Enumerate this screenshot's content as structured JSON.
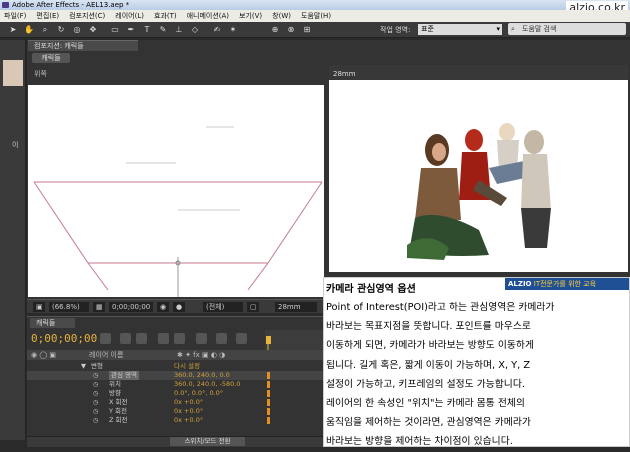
{
  "window": {
    "title": "Adobe After Effects - AEL13.aep *"
  },
  "watermark": "alzio.co.kr",
  "menu": [
    "파일(F)",
    "편집(E)",
    "컴포지션(C)",
    "레이어(L)",
    "효과(T)",
    "애니메이션(A)",
    "보기(V)",
    "창(W)",
    "도움말(H)"
  ],
  "toolbar": {
    "workspace_label": "작업 영역:",
    "workspace_value": "표준",
    "help_placeholder": "도움말 검색"
  },
  "left_panel": {
    "label": "이"
  },
  "composition": {
    "tab_label": "컴포지션: 캐릭들",
    "sub_tab": "캐릭들",
    "view_a_label": "위쪽",
    "view_b_label": "28mm",
    "zoom": "(66.8%)",
    "timecode": "0;00;00;00",
    "view_mode": "(전체)",
    "camera": "28mm"
  },
  "timeline": {
    "tab_label": "캐릭들",
    "timecode": "0;00;00;00",
    "column_header": "레이어 이름",
    "column_header2": "다시 설정",
    "switch_button": "스위치/모드 전환",
    "rows": [
      {
        "name": "변형",
        "value": "다시 설정"
      },
      {
        "name": "관심 영역",
        "value": "360.0, 240.0, 0.0"
      },
      {
        "name": "위치",
        "value": "360.0, 240.0, -580.0"
      },
      {
        "name": "방향",
        "value": "0.0°, 0.0°, 0.0°"
      },
      {
        "name": "X 회전",
        "value": "0x +0.0°"
      },
      {
        "name": "Y 회전",
        "value": "0x +0.0°"
      },
      {
        "name": "Z 회전",
        "value": "0x +0.0°"
      }
    ]
  },
  "info": {
    "title": "카메라 관심영역 옵션",
    "badge_brand": "ALZIO",
    "badge_text": "IT전문가를 위한 교육",
    "lines": [
      "Point of Interest(POI)라고 하는 관심영역은 카메라가",
      "바라보는 목표지점을 뜻합니다. 포인트를 마우스로",
      "이동하게 되면, 카메라가 바라보는 방향도 이동하게",
      "됩니다. 길게 혹은, 짧게 이동이 가능하며, X, Y, Z",
      "설정이 가능하고, 키프레임의 설정도 가능합니다.",
      "레이어의 한 속성인 \"위치\"는 카메라 몸통 전체의",
      "움직임을 제어하는 것이라면, 관심영역은 카메라가",
      "바라보는 방향을 제어하는 차이점이 있습니다."
    ]
  },
  "colors": {
    "accent_orange": "#e6b33b",
    "badge_blue": "#1f4f95",
    "camera_line": "#c47a8a"
  }
}
